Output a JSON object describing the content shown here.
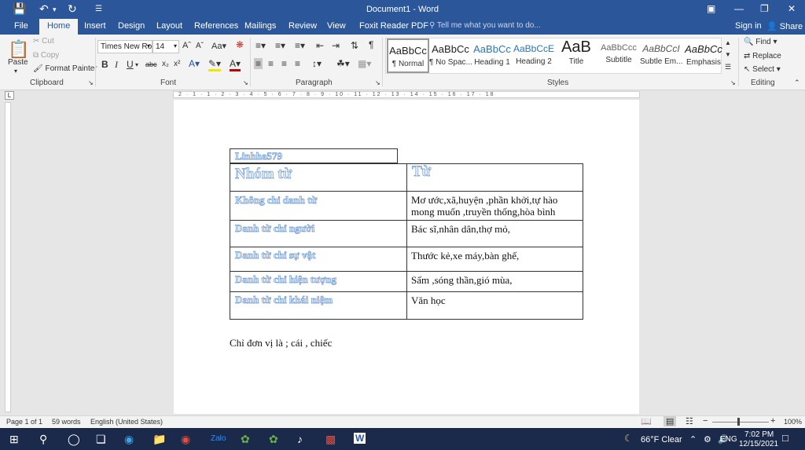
{
  "window": {
    "title": "Document1 - Word"
  },
  "titlebar": {
    "sign_in": "Sign in",
    "share": "Share"
  },
  "tabs": [
    "File",
    "Home",
    "Insert",
    "Design",
    "Layout",
    "References",
    "Mailings",
    "Review",
    "View",
    "Foxit Reader PDF"
  ],
  "tell_me": {
    "placeholder": "Tell me what you want to do..."
  },
  "clipboard": {
    "paste": "Paste",
    "cut": "Cut",
    "copy": "Copy",
    "format_painter": "Format Painter",
    "label": "Clipboard"
  },
  "font": {
    "name": "Times New Ro",
    "size": "14",
    "label": "Font",
    "bold": "B",
    "italic": "I",
    "underline": "U",
    "strike": "abc"
  },
  "paragraph": {
    "label": "Paragraph"
  },
  "styles": {
    "label": "Styles",
    "items": [
      {
        "preview": "AaBbCc",
        "name": "¶ Normal"
      },
      {
        "preview": "AaBbCc",
        "name": "¶ No Spac..."
      },
      {
        "preview": "AaBbCc",
        "name": "Heading 1"
      },
      {
        "preview": "AaBbCcE",
        "name": "Heading 2"
      },
      {
        "preview": "AaB",
        "name": "Title"
      },
      {
        "preview": "AaBbCcc",
        "name": "Subtitle"
      },
      {
        "preview": "AaBbCcI",
        "name": "Subtle Em..."
      },
      {
        "preview": "AaBbCc",
        "name": "Emphasis"
      }
    ]
  },
  "editing": {
    "find": "Find",
    "replace": "Replace",
    "select": "Select",
    "label": "Editing"
  },
  "ruler": {
    "text": "2 · 1 · 1 · 2 · 3 · 4 · 5 · 6 · 7 · 8 · 9 · 10 · 11 · 12 · 13 · 14 · 15 · 16 · 17 · 18"
  },
  "document": {
    "header_box": "Linhha579",
    "table": [
      {
        "left": "Nhóm từ",
        "right": "Từ"
      },
      {
        "left": "Không chỉ danh từ",
        "right": "Mơ ước,xã,huyện ,phần khởi,tự hào mong muốn ,truyền thống,hòa bình"
      },
      {
        "left": "Danh từ chỉ người",
        "right": "Bác sĩ,nhân dân,thợ mỏ,"
      },
      {
        "left": "Danh từ chỉ sự vật",
        "right": "Thước kẻ,xe máy,bàn ghế,"
      },
      {
        "left": "Danh từ chỉ hiện tượng",
        "right": "Sấm ,sóng thần,gió mùa,"
      },
      {
        "left": "Danh từ chỉ khái niệm",
        "right": "Văn học"
      }
    ],
    "paragraph": "Chỉ đơn vị là ; cái , chiếc"
  },
  "status": {
    "page": "Page 1 of 1",
    "words": "59 words",
    "language": "English (United States)",
    "zoom": "100%"
  },
  "taskbar": {
    "weather": "66°F  Clear",
    "lang": "ENG",
    "time": "7:02 PM",
    "date": "12/15/2021"
  }
}
